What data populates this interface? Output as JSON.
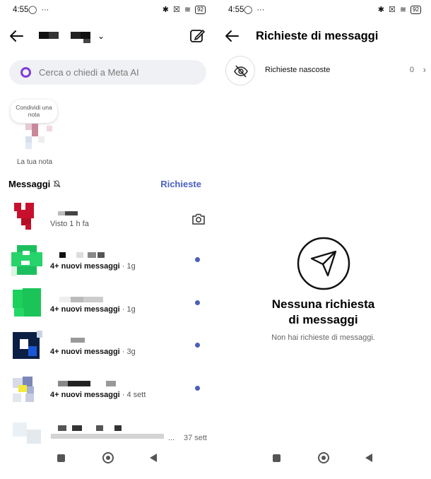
{
  "status_bar": {
    "time": "4:55",
    "battery": "92",
    "icons": [
      "whatsapp-icon",
      "more-icon",
      "bluetooth-icon",
      "no-sim-icon",
      "wifi-icon",
      "battery-icon"
    ]
  },
  "inbox": {
    "search": {
      "placeholder": "Cerca o chiedi a Meta AI"
    },
    "note": {
      "bubble_text": "Condividi una nota",
      "label": "La tua nota"
    },
    "section_title": "Messaggi",
    "requests_link": "Richieste",
    "threads": [
      {
        "subtitle_bold": "",
        "subtitle": "Visto 1 h fa",
        "action": "camera-icon",
        "unread": false
      },
      {
        "subtitle_bold": "4+ nuovi messaggi",
        "subtitle": " · 1g",
        "unread": true
      },
      {
        "subtitle_bold": "4+ nuovi messaggi",
        "subtitle": " · 1g",
        "unread": true
      },
      {
        "subtitle_bold": "4+ nuovi messaggi",
        "subtitle": " · 3g",
        "unread": true
      },
      {
        "subtitle_bold": "4+ nuovi messaggi",
        "subtitle": " · 4 sett",
        "unread": true
      },
      {
        "subtitle_bold": "",
        "subtitle": "...",
        "time": "37 sett",
        "unread": false
      }
    ]
  },
  "requests": {
    "title": "Richieste di messaggi",
    "hidden_requests": {
      "label": "Richieste nascoste",
      "count": "0"
    },
    "empty": {
      "title": "Nessuna richiesta di messaggi",
      "subtitle": "Non hai richieste di messaggi."
    }
  },
  "colors": {
    "accent": "#4a5fbf",
    "meta_ai": "#7e3cdc",
    "unread_dot": "#4a5fbf"
  }
}
